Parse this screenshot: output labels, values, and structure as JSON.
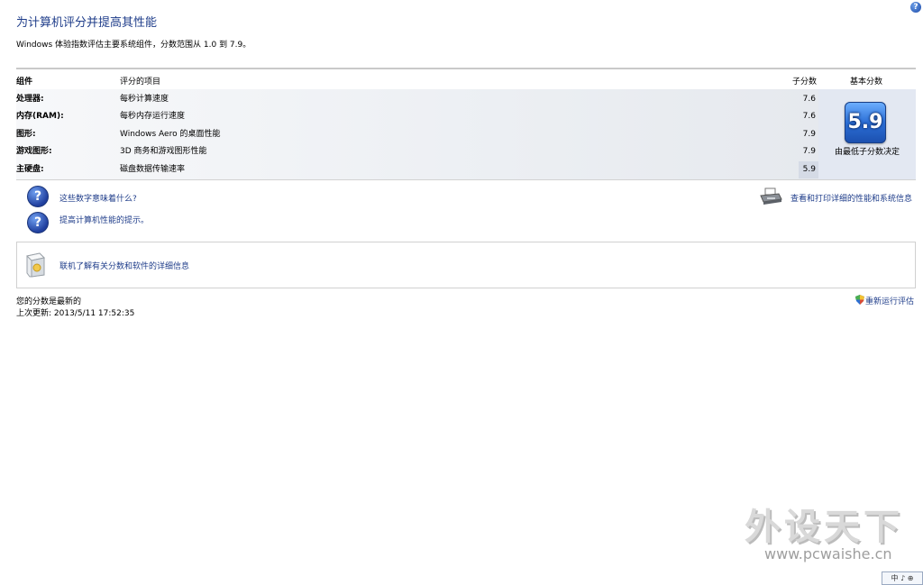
{
  "header": {
    "title": "为计算机评分并提高其性能",
    "subtitle": "Windows 体验指数评估主要系统组件，分数范围从 1.0 到 7.9。",
    "help_glyph": "?"
  },
  "table": {
    "columns": {
      "component": "组件",
      "item": "评分的项目",
      "subscore": "子分数",
      "base_score": "基本分数"
    },
    "rows": [
      {
        "component": "处理器:",
        "item": "每秒计算速度",
        "subscore": "7.6"
      },
      {
        "component": "内存(RAM):",
        "item": "每秒内存运行速度",
        "subscore": "7.6"
      },
      {
        "component": "图形:",
        "item": "Windows Aero 的桌面性能",
        "subscore": "7.9"
      },
      {
        "component": "游戏图形:",
        "item": "3D 商务和游戏图形性能",
        "subscore": "7.9"
      },
      {
        "component": "主硬盘:",
        "item": "磁盘数据传输速率",
        "subscore": "5.9"
      }
    ],
    "base_score": "5.9",
    "base_score_note": "由最低子分数决定"
  },
  "links": {
    "what_numbers_mean": "这些数字意味着什么?",
    "improve_tips": "提高计算机性能的提示。",
    "print_details": "查看和打印详细的性能和系统信息",
    "online_info": "联机了解有关分数和软件的详细信息",
    "question_glyph": "?"
  },
  "status": {
    "line1": "您的分数是最新的",
    "line2": "上次更新: 2013/5/11 17:52:35",
    "rerun": "重新运行评估"
  },
  "watermark": {
    "cn": "外设天下",
    "en": "www.pcwaishe.cn"
  },
  "ime": {
    "label": "中 ♪ ⊕"
  },
  "colors": {
    "link": "#1f3d8a",
    "badge": "#2c6fd6"
  },
  "icons": [
    "help-icon",
    "question-icon",
    "printer-icon",
    "package-icon",
    "shield-icon"
  ]
}
